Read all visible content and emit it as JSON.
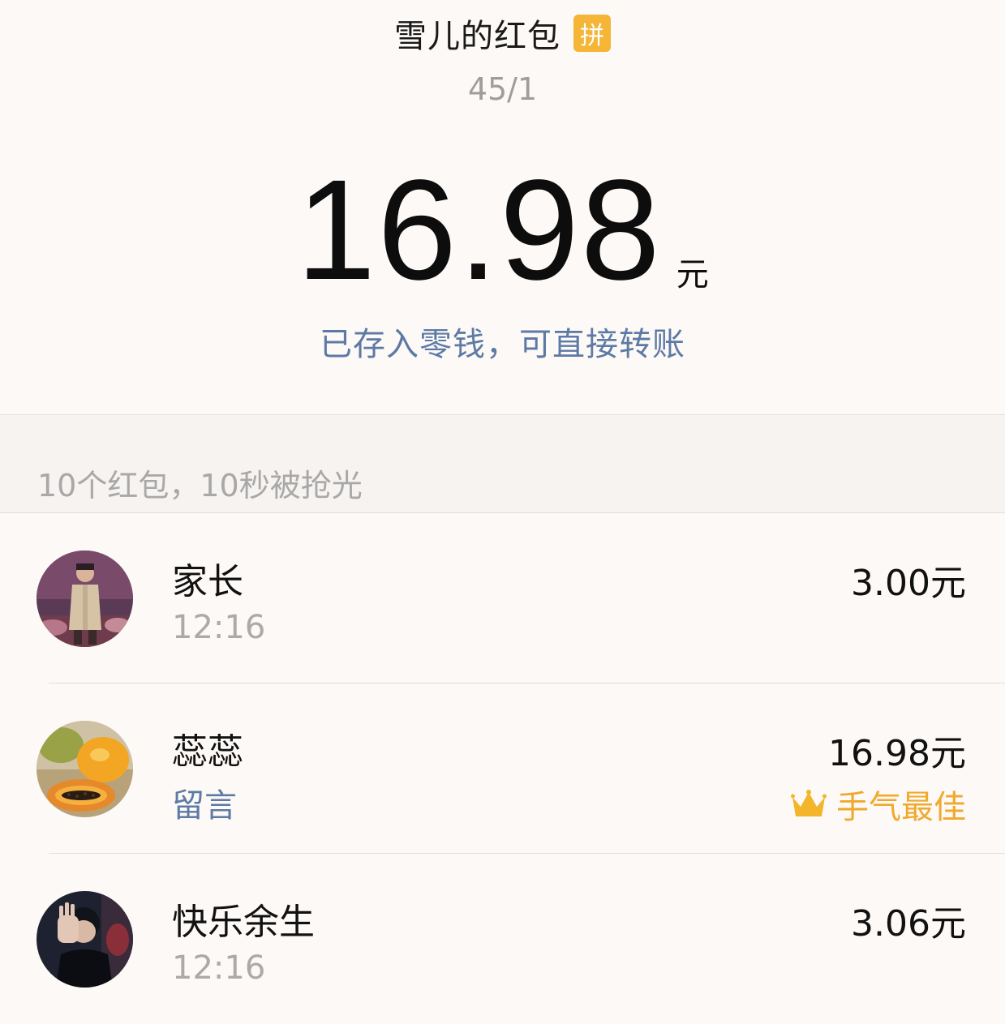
{
  "header": {
    "title": "雪儿的红包",
    "badge": "拼",
    "count": "45/1",
    "amount": "16.98",
    "amount_unit": "元",
    "notice": "已存入零钱，可直接转账"
  },
  "summary": {
    "text": "10个红包，10秒被抢光"
  },
  "list": [
    {
      "name": "家长",
      "sub": "12:16",
      "amount": "3.00元",
      "best_label": "",
      "avatar_icon": "child-photo-avatar"
    },
    {
      "name": "蕊蕊",
      "sub": "留言",
      "amount": "16.98元",
      "best_label": "手气最佳",
      "avatar_icon": "papaya-photo-avatar"
    },
    {
      "name": "快乐余生",
      "sub": "12:16",
      "amount": "3.06元",
      "best_label": "",
      "avatar_icon": "boy-photo-avatar"
    }
  ],
  "colors": {
    "background": "#fcf9f6",
    "link_blue": "#5d7aa5",
    "best_gold": "#f0a92d",
    "badge_orange": "#f5b537"
  }
}
